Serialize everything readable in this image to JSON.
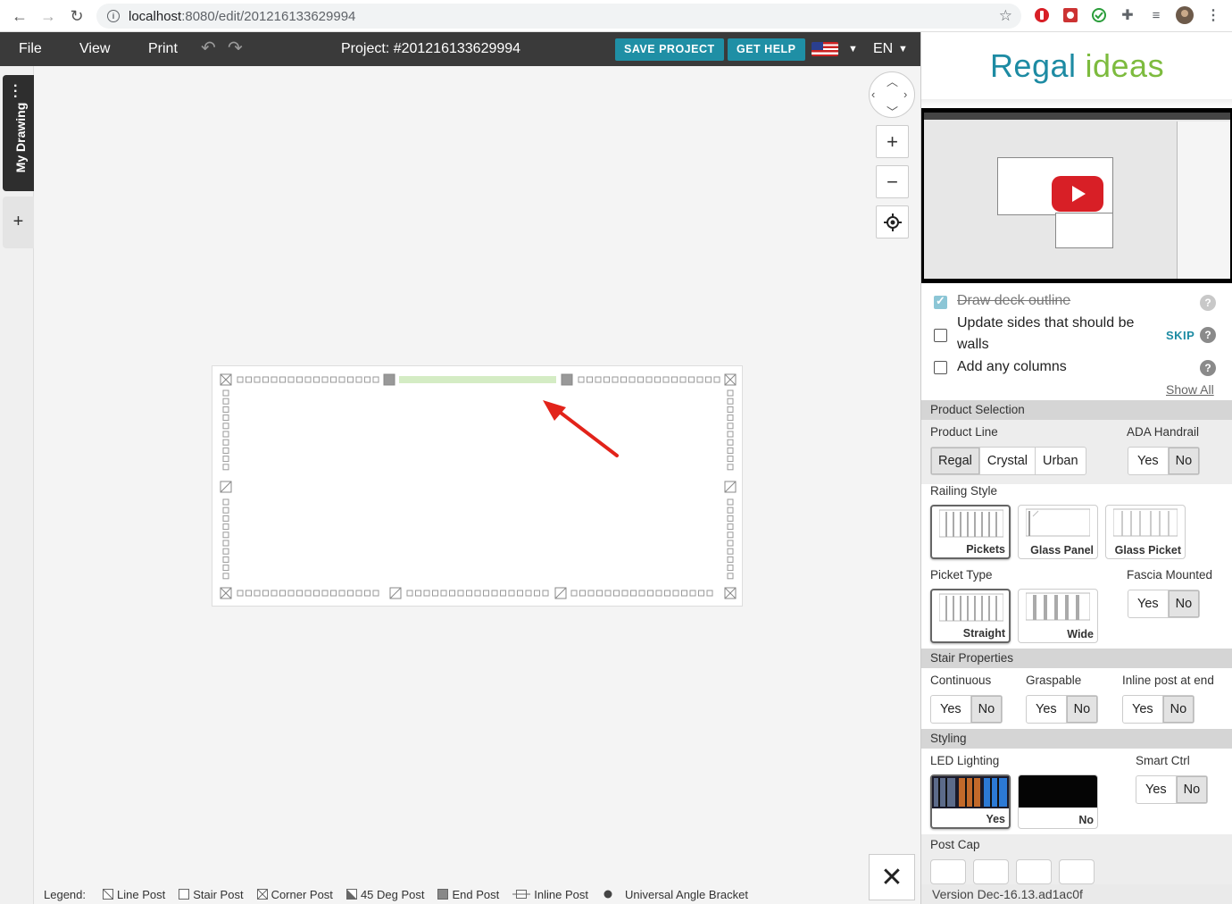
{
  "browser": {
    "url_host": "localhost",
    "url_path": ":8080/edit/201216133629994"
  },
  "toolbar": {
    "file": "File",
    "view": "View",
    "print": "Print",
    "project_title": "Project: #201216133629994",
    "save_project": "SAVE PROJECT",
    "get_help": "GET HELP",
    "language": "EN"
  },
  "sidebar": {
    "my_drawing": "My Drawing",
    "add": "+"
  },
  "canvas": {
    "zoom_in": "+",
    "zoom_out": "−",
    "close": "✕"
  },
  "legend": {
    "title": "Legend:",
    "items": [
      "Line Post",
      "Stair Post",
      "Corner Post",
      "45 Deg Post",
      "End Post",
      "Inline Post",
      "Universal Angle Bracket"
    ]
  },
  "panel": {
    "logo_regal": "Regal",
    "logo_ideas": "ideas",
    "steps": [
      {
        "label": "Draw deck outline",
        "checked": true
      },
      {
        "label": "Update sides that should be",
        "label2": "walls",
        "checked": false
      },
      {
        "label": "Add any columns",
        "checked": false
      }
    ],
    "skip": "SKIP",
    "show_all": "Show All",
    "product_selection": "Product Selection",
    "product_line_label": "Product Line",
    "product_lines": [
      "Regal",
      "Crystal",
      "Urban"
    ],
    "ada_handrail_label": "ADA Handrail",
    "yes": "Yes",
    "no": "No",
    "railing_style_label": "Railing Style",
    "railing_styles": [
      "Pickets",
      "Glass Panel",
      "Glass Picket"
    ],
    "picket_type_label": "Picket Type",
    "picket_types": [
      "Straight",
      "Wide"
    ],
    "fascia_mounted_label": "Fascia Mounted",
    "stair_properties": "Stair Properties",
    "continuous_label": "Continuous",
    "graspable_label": "Graspable",
    "inline_post_label": "Inline post at end",
    "styling": "Styling",
    "led_lighting_label": "LED Lighting",
    "led_yes": "Yes",
    "led_no": "No",
    "smart_ctrl_label": "Smart Ctrl",
    "post_cap_label": "Post Cap",
    "version": "Version  Dec-16.13.ad1ac0f"
  },
  "colors": {
    "accent": "#1f8fa5",
    "toolbar": "#3a3a3a",
    "selected_span": "#d4ecc4",
    "arrow": "#e2231a"
  }
}
